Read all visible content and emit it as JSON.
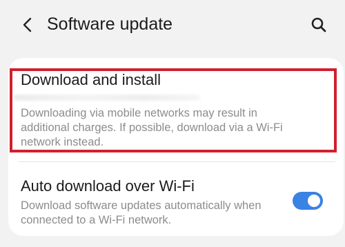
{
  "header": {
    "back_icon": "chevron-left-icon",
    "title": "Software update",
    "search_icon": "search-icon"
  },
  "download_install": {
    "title": "Download and install",
    "description": "Downloading via mobile networks may result in additional charges. If possible, download via a Wi-Fi network instead.",
    "highlighted": true,
    "highlight_color": "#d0202e"
  },
  "auto_download": {
    "title": "Auto download over Wi-Fi",
    "description": "Download software updates automatically when connected to a Wi-Fi network.",
    "enabled": true,
    "toggle_color": "#3a82e4"
  }
}
